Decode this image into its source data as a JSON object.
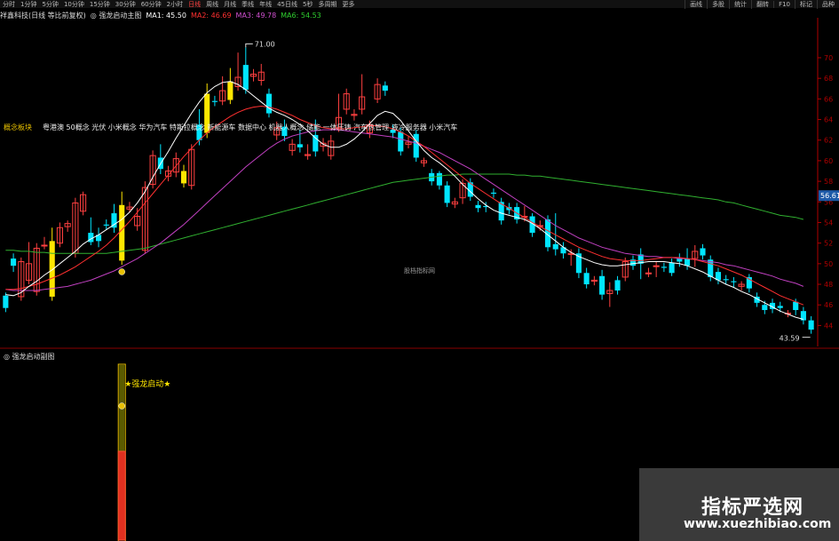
{
  "periods": [
    "分时",
    "1分钟",
    "5分钟",
    "10分钟",
    "15分钟",
    "30分钟",
    "60分钟",
    "2小时",
    "日线",
    "周线",
    "月线",
    "季线",
    "年线",
    "45日线",
    "5秒",
    "多周期",
    "更多"
  ],
  "active_period": "日线",
  "tools": [
    "画线",
    "多股",
    "统计",
    "翻转",
    "F10",
    "标记",
    "品种"
  ],
  "title": {
    "stock": "祥鑫科技(日线 等比前复权)",
    "indicator": "◎ 强龙启动主图",
    "ma1": "MA1: 45.50",
    "ma2": "MA2: 46.69",
    "ma3": "MA3: 49.78",
    "ma6": "MA6: 54.53"
  },
  "colors": {
    "up": "#00e5ff",
    "down": "#ff4040",
    "yellow_bar": "#ffe600",
    "ma1": "#ffffff",
    "ma2": "#ff3030",
    "ma3": "#c040c0",
    "ma6": "#30b030",
    "signal": "#ffe600"
  },
  "concepts": {
    "label": "概念板块",
    "list": "粤港澳 50概念 光伏 小米概念 华为汽车 特斯拉概念 新能源车 数据中心 机器人概念 储能 一体压铸 汽车热管理 液冷服务器 小米汽车"
  },
  "center_watermark": "股档指标网",
  "sub_title": "◎ 强龙启动副图",
  "signal_label": "★强龙启动★",
  "watermark": {
    "cn": "指标严选网",
    "url": "www.xuezhibiao.com"
  },
  "chart_data": {
    "type": "candlestick",
    "y_ticks": [
      44,
      46,
      48,
      50,
      52,
      54,
      56,
      58,
      60,
      62,
      64,
      66,
      68,
      70
    ],
    "ylim": [
      43,
      72.5
    ],
    "high_annotation": "71.00",
    "low_annotation": "43.59",
    "price_tag": "56.61",
    "candles": [
      {
        "o": 46.9,
        "c": 45.7,
        "h": 47.2,
        "l": 45.3
      },
      {
        "o": 50.5,
        "c": 49.8,
        "h": 51.0,
        "l": 49.2
      },
      {
        "o": 46.8,
        "c": 50.2,
        "h": 50.6,
        "l": 46.4
      },
      {
        "o": 48.4,
        "c": 50.0,
        "h": 52.1,
        "l": 48.0
      },
      {
        "o": 47.3,
        "c": 51.5,
        "h": 52.0,
        "l": 46.9
      },
      {
        "o": 51.8,
        "c": 51.8,
        "h": 52.6,
        "l": 51.4
      },
      {
        "o": 46.8,
        "c": 52.2,
        "h": 53.5,
        "l": 46.4
      },
      {
        "o": 52.0,
        "c": 53.5,
        "h": 54.0,
        "l": 51.6
      },
      {
        "o": 53.6,
        "c": 53.9,
        "h": 54.2,
        "l": 53.1
      },
      {
        "o": 51.0,
        "c": 55.9,
        "h": 56.4,
        "l": 50.6
      },
      {
        "o": 55.1,
        "c": 56.7,
        "h": 57.0,
        "l": 54.7
      },
      {
        "o": 53.0,
        "c": 52.1,
        "h": 54.5,
        "l": 51.8
      },
      {
        "o": 52.8,
        "c": 52.2,
        "h": 53.5,
        "l": 51.6
      },
      {
        "o": 53.8,
        "c": 53.7,
        "h": 54.3,
        "l": 53.3
      },
      {
        "o": 54.9,
        "c": 53.5,
        "h": 55.8,
        "l": 53.0
      },
      {
        "o": 50.3,
        "c": 55.7,
        "h": 57.0,
        "l": 49.9
      },
      {
        "o": 55.3,
        "c": 55.5,
        "h": 56.0,
        "l": 55.0
      },
      {
        "o": 53.7,
        "c": 54.6,
        "h": 55.4,
        "l": 53.2
      },
      {
        "o": 51.3,
        "c": 57.4,
        "h": 58.0,
        "l": 51.0
      },
      {
        "o": 57.7,
        "c": 60.5,
        "h": 61.0,
        "l": 57.3
      },
      {
        "o": 60.3,
        "c": 59.2,
        "h": 61.6,
        "l": 58.7
      },
      {
        "o": 58.5,
        "c": 59.0,
        "h": 59.5,
        "l": 58.0
      },
      {
        "o": 58.9,
        "c": 60.2,
        "h": 60.8,
        "l": 58.4
      },
      {
        "o": 57.8,
        "c": 59.0,
        "h": 59.6,
        "l": 57.4
      },
      {
        "o": 57.6,
        "c": 61.1,
        "h": 61.6,
        "l": 57.2
      },
      {
        "o": 63.5,
        "c": 62.0,
        "h": 65.0,
        "l": 61.5
      },
      {
        "o": 66.5,
        "c": 62.7,
        "h": 67.5,
        "l": 62.2
      },
      {
        "o": 65.8,
        "c": 65.7,
        "h": 66.3,
        "l": 65.3
      },
      {
        "o": 65.8,
        "c": 66.8,
        "h": 68.2,
        "l": 65.4
      },
      {
        "o": 67.7,
        "c": 65.9,
        "h": 69.0,
        "l": 65.5
      },
      {
        "o": 67.2,
        "c": 68.1,
        "h": 70.5,
        "l": 66.8
      },
      {
        "o": 69.3,
        "c": 66.9,
        "h": 71.0,
        "l": 66.5
      },
      {
        "o": 68.2,
        "c": 68.4,
        "h": 68.9,
        "l": 67.7
      },
      {
        "o": 67.8,
        "c": 68.6,
        "h": 69.4,
        "l": 67.3
      },
      {
        "o": 66.5,
        "c": 64.6,
        "h": 67.0,
        "l": 64.2
      },
      {
        "o": 62.5,
        "c": 63.2,
        "h": 63.8,
        "l": 62.0
      },
      {
        "o": 63.3,
        "c": 62.4,
        "h": 64.0,
        "l": 61.9
      },
      {
        "o": 61.0,
        "c": 61.6,
        "h": 62.1,
        "l": 60.5
      },
      {
        "o": 61.6,
        "c": 61.3,
        "h": 63.0,
        "l": 60.8
      },
      {
        "o": 60.5,
        "c": 60.6,
        "h": 61.6,
        "l": 60.1
      },
      {
        "o": 62.5,
        "c": 60.9,
        "h": 64.0,
        "l": 60.4
      },
      {
        "o": 61.4,
        "c": 61.7,
        "h": 62.2,
        "l": 60.9
      },
      {
        "o": 60.5,
        "c": 61.9,
        "h": 62.5,
        "l": 60.1
      },
      {
        "o": 63.2,
        "c": 64.2,
        "h": 66.5,
        "l": 62.8
      },
      {
        "o": 65.0,
        "c": 66.5,
        "h": 67.0,
        "l": 64.5
      },
      {
        "o": 64.4,
        "c": 64.5,
        "h": 65.0,
        "l": 63.9
      },
      {
        "o": 65.0,
        "c": 66.2,
        "h": 68.4,
        "l": 64.5
      },
      {
        "o": 62.7,
        "c": 63.5,
        "h": 63.9,
        "l": 62.2
      },
      {
        "o": 66.0,
        "c": 67.4,
        "h": 68.0,
        "l": 65.6
      },
      {
        "o": 67.3,
        "c": 66.8,
        "h": 67.7,
        "l": 66.3
      },
      {
        "o": 63.0,
        "c": 62.7,
        "h": 63.5,
        "l": 62.2
      },
      {
        "o": 62.8,
        "c": 60.9,
        "h": 63.2,
        "l": 60.5
      },
      {
        "o": 61.6,
        "c": 61.8,
        "h": 62.4,
        "l": 61.2
      },
      {
        "o": 62.6,
        "c": 60.3,
        "h": 63.0,
        "l": 59.9
      },
      {
        "o": 59.8,
        "c": 60.0,
        "h": 60.3,
        "l": 59.4
      },
      {
        "o": 58.8,
        "c": 58.0,
        "h": 59.2,
        "l": 57.6
      },
      {
        "o": 58.8,
        "c": 57.6,
        "h": 59.0,
        "l": 57.2
      },
      {
        "o": 57.6,
        "c": 55.9,
        "h": 58.0,
        "l": 55.5
      },
      {
        "o": 55.8,
        "c": 56.0,
        "h": 56.4,
        "l": 55.4
      },
      {
        "o": 56.4,
        "c": 57.8,
        "h": 58.2,
        "l": 55.8
      },
      {
        "o": 57.9,
        "c": 56.5,
        "h": 58.3,
        "l": 56.1
      },
      {
        "o": 55.7,
        "c": 55.4,
        "h": 56.1,
        "l": 55.0
      },
      {
        "o": 55.6,
        "c": 55.5,
        "h": 56.0,
        "l": 55.0
      },
      {
        "o": 56.9,
        "c": 56.8,
        "h": 57.3,
        "l": 56.4
      },
      {
        "o": 56.0,
        "c": 54.2,
        "h": 56.4,
        "l": 53.8
      },
      {
        "o": 55.5,
        "c": 55.2,
        "h": 55.9,
        "l": 54.8
      },
      {
        "o": 55.5,
        "c": 54.3,
        "h": 55.9,
        "l": 53.9
      },
      {
        "o": 54.6,
        "c": 54.6,
        "h": 55.6,
        "l": 54.1
      },
      {
        "o": 54.6,
        "c": 53.0,
        "h": 54.9,
        "l": 52.6
      },
      {
        "o": 53.7,
        "c": 53.7,
        "h": 54.2,
        "l": 53.2
      },
      {
        "o": 54.3,
        "c": 51.6,
        "h": 54.7,
        "l": 51.2
      },
      {
        "o": 51.9,
        "c": 51.4,
        "h": 54.9,
        "l": 50.8
      },
      {
        "o": 51.6,
        "c": 51.0,
        "h": 52.1,
        "l": 50.5
      },
      {
        "o": 50.9,
        "c": 51.0,
        "h": 51.4,
        "l": 49.8
      },
      {
        "o": 51.0,
        "c": 49.1,
        "h": 51.5,
        "l": 48.6
      },
      {
        "o": 49.1,
        "c": 48.0,
        "h": 49.6,
        "l": 47.6
      },
      {
        "o": 48.3,
        "c": 48.4,
        "h": 48.8,
        "l": 47.9
      },
      {
        "o": 48.8,
        "c": 47.0,
        "h": 49.4,
        "l": 46.5
      },
      {
        "o": 47.1,
        "c": 47.4,
        "h": 48.2,
        "l": 45.8
      },
      {
        "o": 48.4,
        "c": 47.4,
        "h": 48.8,
        "l": 47.0
      },
      {
        "o": 48.7,
        "c": 50.2,
        "h": 50.6,
        "l": 48.3
      },
      {
        "o": 50.4,
        "c": 49.8,
        "h": 50.8,
        "l": 49.4
      },
      {
        "o": 50.9,
        "c": 50.0,
        "h": 51.5,
        "l": 48.5
      },
      {
        "o": 49.1,
        "c": 49.1,
        "h": 49.6,
        "l": 48.7
      },
      {
        "o": 49.8,
        "c": 49.8,
        "h": 50.2,
        "l": 48.7
      },
      {
        "o": 49.7,
        "c": 49.6,
        "h": 50.1,
        "l": 49.2
      },
      {
        "o": 50.1,
        "c": 49.1,
        "h": 50.5,
        "l": 48.8
      },
      {
        "o": 50.5,
        "c": 50.2,
        "h": 51.0,
        "l": 49.7
      },
      {
        "o": 50.5,
        "c": 49.8,
        "h": 51.5,
        "l": 49.4
      },
      {
        "o": 50.5,
        "c": 51.2,
        "h": 51.8,
        "l": 49.7
      },
      {
        "o": 51.5,
        "c": 50.8,
        "h": 51.9,
        "l": 50.4
      },
      {
        "o": 50.4,
        "c": 48.7,
        "h": 50.8,
        "l": 48.3
      },
      {
        "o": 49.2,
        "c": 48.4,
        "h": 49.6,
        "l": 48.0
      },
      {
        "o": 48.5,
        "c": 48.4,
        "h": 48.9,
        "l": 48.0
      },
      {
        "o": 48.3,
        "c": 48.2,
        "h": 48.7,
        "l": 47.7
      },
      {
        "o": 47.8,
        "c": 48.0,
        "h": 48.3,
        "l": 47.4
      },
      {
        "o": 48.7,
        "c": 47.6,
        "h": 49.0,
        "l": 47.2
      },
      {
        "o": 46.8,
        "c": 46.2,
        "h": 47.2,
        "l": 45.8
      },
      {
        "o": 46.0,
        "c": 45.5,
        "h": 46.4,
        "l": 45.1
      },
      {
        "o": 46.2,
        "c": 45.6,
        "h": 46.6,
        "l": 45.2
      },
      {
        "o": 45.9,
        "c": 45.7,
        "h": 46.3,
        "l": 45.3
      },
      {
        "o": 45.2,
        "c": 45.2,
        "h": 45.5,
        "l": 44.8
      },
      {
        "o": 46.3,
        "c": 45.5,
        "h": 46.6,
        "l": 45.0
      },
      {
        "o": 45.4,
        "c": 44.5,
        "h": 45.8,
        "l": 44.1
      },
      {
        "o": 44.5,
        "c": 43.6,
        "h": 44.9,
        "l": 43.2
      }
    ],
    "yellow_bars": [
      6,
      15,
      23,
      26,
      29
    ],
    "ma1": [
      47.0,
      46.9,
      47.2,
      47.8,
      48.3,
      48.9,
      49.4,
      50.0,
      50.6,
      51.2,
      51.9,
      52.4,
      52.8,
      53.3,
      53.8,
      54.3,
      55.0,
      55.9,
      57.0,
      58.4,
      59.7,
      60.9,
      62.2,
      63.4,
      64.6,
      65.7,
      66.6,
      67.2,
      67.6,
      67.7,
      67.4,
      66.9,
      66.3,
      65.7,
      65.1,
      64.7,
      64.4,
      64.0,
      63.5,
      62.9,
      62.2,
      61.6,
      61.3,
      61.3,
      61.6,
      62.1,
      62.8,
      63.6,
      64.4,
      64.8,
      64.6,
      63.9,
      62.9,
      61.9,
      61.0,
      60.3,
      59.8,
      59.2,
      58.5,
      57.7,
      57.0,
      56.3,
      55.7,
      55.2,
      54.9,
      54.7,
      54.5,
      54.3,
      53.9,
      53.4,
      52.8,
      52.2,
      51.6,
      51.1,
      50.7,
      50.4,
      50.1,
      49.9,
      49.8,
      49.8,
      49.9,
      50.0,
      50.1,
      50.2,
      50.2,
      50.2,
      50.1,
      50.0,
      49.8,
      49.5,
      49.2,
      48.8,
      48.4,
      48.0,
      47.7,
      47.3,
      47.0,
      46.6,
      46.2,
      45.8,
      45.4,
      45.1,
      44.8,
      44.6
    ],
    "ma2": [
      47.5,
      47.5,
      47.6,
      47.8,
      48.0,
      48.3,
      48.6,
      48.9,
      49.3,
      49.7,
      50.2,
      50.7,
      51.2,
      51.8,
      52.5,
      53.3,
      54.1,
      55.0,
      55.9,
      56.8,
      57.7,
      58.6,
      59.5,
      60.4,
      61.2,
      62.0,
      62.7,
      63.3,
      63.8,
      64.3,
      64.7,
      65.0,
      65.2,
      65.3,
      65.2,
      65.0,
      64.7,
      64.4,
      64.0,
      63.7,
      63.4,
      63.2,
      63.1,
      63.1,
      63.1,
      63.2,
      63.3,
      63.4,
      63.4,
      63.3,
      63.1,
      62.8,
      62.4,
      61.9,
      61.4,
      60.8,
      60.2,
      59.6,
      59.0,
      58.4,
      57.8,
      57.3,
      56.8,
      56.3,
      55.8,
      55.4,
      54.9,
      54.5,
      54.0,
      53.6,
      53.2,
      52.8,
      52.4,
      52.0,
      51.6,
      51.3,
      51.0,
      50.7,
      50.5,
      50.4,
      50.3,
      50.3,
      50.3,
      50.4,
      50.5,
      50.6,
      50.6,
      50.6,
      50.5,
      50.4,
      50.2,
      50.0,
      49.8,
      49.5,
      49.2,
      48.9,
      48.5,
      48.1,
      47.7,
      47.3,
      46.9,
      46.6,
      46.3,
      46.0
    ],
    "ma3": [
      47.5,
      47.4,
      47.4,
      47.4,
      47.4,
      47.5,
      47.6,
      47.7,
      47.8,
      48.0,
      48.2,
      48.4,
      48.7,
      49.0,
      49.3,
      49.7,
      50.1,
      50.5,
      51.0,
      51.5,
      52.0,
      52.6,
      53.2,
      53.8,
      54.5,
      55.2,
      55.9,
      56.6,
      57.3,
      58.0,
      58.7,
      59.4,
      60.0,
      60.6,
      61.2,
      61.7,
      62.1,
      62.4,
      62.6,
      62.8,
      62.9,
      63.0,
      63.0,
      63.0,
      62.9,
      62.8,
      62.7,
      62.6,
      62.5,
      62.4,
      62.3,
      62.1,
      61.9,
      61.7,
      61.4,
      61.1,
      60.8,
      60.4,
      60.0,
      59.6,
      59.2,
      58.7,
      58.2,
      57.7,
      57.2,
      56.7,
      56.2,
      55.7,
      55.2,
      54.7,
      54.2,
      53.7,
      53.3,
      52.9,
      52.5,
      52.2,
      51.9,
      51.6,
      51.4,
      51.2,
      51.0,
      50.9,
      50.8,
      50.7,
      50.7,
      50.6,
      50.6,
      50.5,
      50.5,
      50.4,
      50.3,
      50.2,
      50.1,
      49.9,
      49.8,
      49.6,
      49.4,
      49.2,
      49.0,
      48.8,
      48.5,
      48.3,
      48.1,
      47.8
    ],
    "ma6": [
      51.3,
      51.3,
      51.2,
      51.2,
      51.1,
      51.1,
      51.0,
      51.0,
      51.0,
      51.0,
      51.0,
      51.0,
      51.0,
      51.0,
      51.1,
      51.2,
      51.3,
      51.4,
      51.5,
      51.7,
      51.9,
      52.1,
      52.3,
      52.5,
      52.7,
      52.9,
      53.1,
      53.3,
      53.5,
      53.7,
      53.9,
      54.1,
      54.3,
      54.5,
      54.7,
      54.9,
      55.1,
      55.3,
      55.5,
      55.7,
      55.9,
      56.1,
      56.3,
      56.5,
      56.7,
      56.9,
      57.1,
      57.3,
      57.5,
      57.7,
      57.9,
      58.0,
      58.1,
      58.2,
      58.3,
      58.4,
      58.5,
      58.6,
      58.6,
      58.7,
      58.7,
      58.7,
      58.7,
      58.7,
      58.7,
      58.7,
      58.6,
      58.6,
      58.5,
      58.5,
      58.4,
      58.3,
      58.2,
      58.1,
      58.0,
      57.9,
      57.8,
      57.7,
      57.6,
      57.5,
      57.4,
      57.3,
      57.2,
      57.1,
      57.0,
      56.9,
      56.8,
      56.7,
      56.6,
      56.5,
      56.4,
      56.3,
      56.2,
      56.0,
      55.9,
      55.7,
      55.5,
      55.3,
      55.1,
      54.9,
      54.7,
      54.6,
      54.5,
      54.3
    ],
    "signal_index": 15,
    "sub_bar_index": 15
  }
}
